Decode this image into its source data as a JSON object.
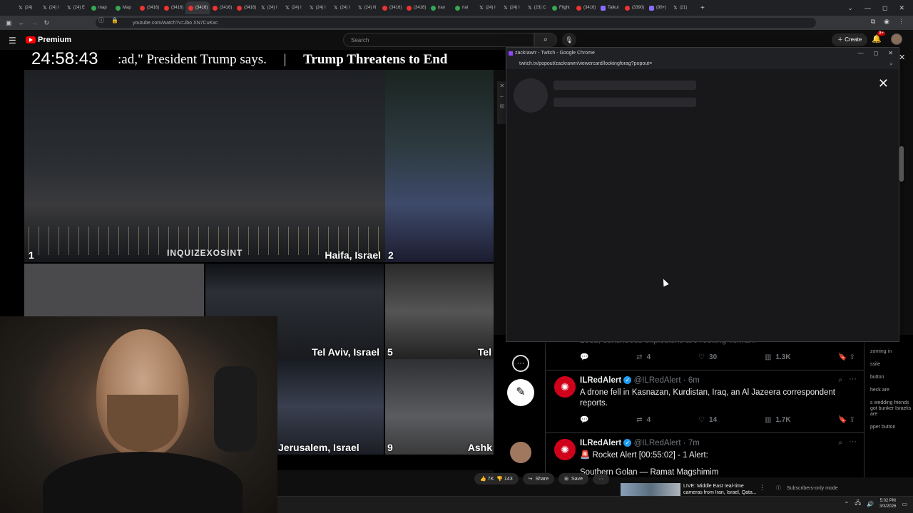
{
  "browser": {
    "tabs": [
      {
        "icon": "x",
        "label": "(24)"
      },
      {
        "icon": "x",
        "label": "(24) I"
      },
      {
        "icon": "x",
        "label": "(24) E"
      },
      {
        "icon": "g",
        "label": "map"
      },
      {
        "icon": "g",
        "label": "Map"
      },
      {
        "icon": "yt",
        "label": "(3416)"
      },
      {
        "icon": "yt",
        "label": "(3416)"
      },
      {
        "icon": "yt",
        "label": "(3416)",
        "active": true
      },
      {
        "icon": "yt",
        "label": "(3416)"
      },
      {
        "icon": "yt",
        "label": "(3416)"
      },
      {
        "icon": "x",
        "label": "(24) I"
      },
      {
        "icon": "x",
        "label": "(24) I"
      },
      {
        "icon": "x",
        "label": "(24) I"
      },
      {
        "icon": "x",
        "label": "(24) I"
      },
      {
        "icon": "x",
        "label": "(24) N"
      },
      {
        "icon": "yt",
        "label": "(3416)"
      },
      {
        "icon": "yt",
        "label": "(3416)"
      },
      {
        "icon": "g",
        "label": "iran"
      },
      {
        "icon": "g",
        "label": "rial"
      },
      {
        "icon": "x",
        "label": "(24) I"
      },
      {
        "icon": "x",
        "label": "(24) I"
      },
      {
        "icon": "x",
        "label": "(23) C"
      },
      {
        "icon": "g",
        "label": "Flight"
      },
      {
        "icon": "yt",
        "label": "(3416)"
      },
      {
        "icon": "p",
        "label": "Talkul"
      },
      {
        "icon": "yt",
        "label": "(3390)"
      },
      {
        "icon": "p",
        "label": "(99+)"
      },
      {
        "icon": "x",
        "label": "(21)"
      }
    ],
    "url": "youtube.com/watch?v=Jbo XN7CuKxc",
    "new_tab": "+",
    "tab_list": "⌄",
    "window_controls": [
      "—",
      "◻",
      "✕"
    ]
  },
  "youtube": {
    "logo_text": "Premium",
    "search_placeholder": "Search",
    "create_label": "Create",
    "notif_count": "9+",
    "like_count": "7K",
    "dislike_count": "143",
    "share_label": "Share",
    "save_label": "Save",
    "recommended_title": "LIVE: Middle East real-time cameras from Iran, Israel, Qata...",
    "subscribers_mode": "Subscribers-only mode"
  },
  "stream": {
    "timer": "24:58:43",
    "ticker_left": ":ad,\" President Trump says.",
    "ticker_sep": "|",
    "ticker_right": "Trump Threatens to End",
    "cams": [
      {
        "num": "1",
        "label": "Haifa, Israel"
      },
      {
        "num": "2",
        "label": ""
      },
      {
        "num": "5",
        "label": "Tel Aviv, Israel"
      },
      {
        "num": "",
        "label": "Tel"
      },
      {
        "num": "9",
        "label": "Jerusalem, Israel"
      },
      {
        "num": "",
        "label": "Ashk"
      }
    ],
    "watermark": "INQUIZEXOSINT"
  },
  "twitch_popup": {
    "title": "zackrawrr - Twitch - Google Chrome",
    "url": "twitch.tv/popout/zackrawrr/viewercard/lookingforag?popout="
  },
  "twitter": {
    "partial_text": "Loud, continuous explosions are rocking Tehran.",
    "partial_stats": {
      "reply": "",
      "retweet": "4",
      "like": "30",
      "views": "1.3K"
    },
    "tweets": [
      {
        "name": "ILRedAlert",
        "handle": "@ILRedAlert",
        "time": "6m",
        "text": "A drone fell in Kasnazan, Kurdistan, Iraq, an Al Jazeera correspondent reports.",
        "retweets": "4",
        "likes": "14",
        "views": "1.7K"
      },
      {
        "name": "ILRedAlert",
        "handle": "@ILRedAlert",
        "time": "7m",
        "text": "🚨 Rocket Alert [00:55:02] - 1 Alert:",
        "subtext": "Southern Golan — Ramat Magshimim"
      }
    ],
    "side_snippets": [
      "zoming in",
      "ssile",
      "button",
      "heck are",
      "s wedding friends got bunker Israelis are",
      "pper button"
    ]
  },
  "taskbar": {
    "time": "5:02 PM",
    "date": "3/3/2026"
  }
}
